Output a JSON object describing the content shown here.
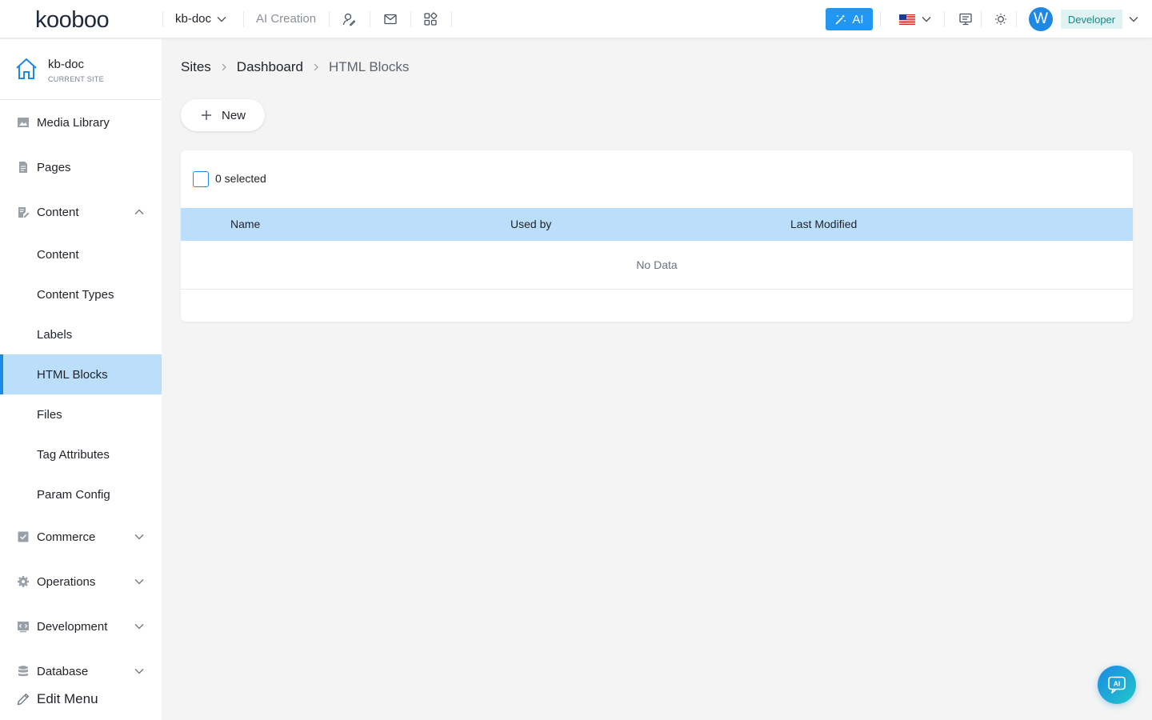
{
  "topbar": {
    "logo": "kooboo",
    "site_name": "kb-doc",
    "ai_creation": "AI Creation",
    "ai_button": "AI",
    "avatar_initial": "W",
    "role": "Developer",
    "icons": [
      "user-edit-icon",
      "mail-icon",
      "apps-grid-icon",
      "monitor-icon",
      "sun-icon"
    ],
    "flag": "us-flag"
  },
  "sidebar": {
    "site": {
      "name": "kb-doc",
      "subtitle": "CURRENT SITE"
    },
    "items": [
      {
        "label": "Media Library",
        "icon": "image-icon"
      },
      {
        "label": "Pages",
        "icon": "page-icon"
      },
      {
        "label": "Content",
        "icon": "content-edit-icon",
        "expanded": true
      },
      {
        "label": "Content"
      },
      {
        "label": "Content Types"
      },
      {
        "label": "Labels"
      },
      {
        "label": "HTML Blocks",
        "active": true
      },
      {
        "label": "Files"
      },
      {
        "label": "Tag Attributes"
      },
      {
        "label": "Param Config"
      },
      {
        "label": "Commerce",
        "icon": "commerce-icon",
        "expanded": false
      },
      {
        "label": "Operations",
        "icon": "gear-icon",
        "expanded": false
      },
      {
        "label": "Development",
        "icon": "code-icon",
        "expanded": false
      },
      {
        "label": "Database",
        "icon": "database-icon",
        "expanded": false
      }
    ],
    "edit_menu": "Edit Menu"
  },
  "breadcrumb": [
    "Sites",
    "Dashboard",
    "HTML Blocks"
  ],
  "toolbar": {
    "new_label": "New"
  },
  "table": {
    "selected_text": "0 selected",
    "columns": [
      "Name",
      "Used by",
      "Last Modified"
    ],
    "empty_text": "No Data"
  },
  "colors": {
    "accent": "#1e88e5",
    "active_bg": "#bbdefb",
    "role_bg": "#e0f2f1",
    "role_text": "#138a8a"
  }
}
